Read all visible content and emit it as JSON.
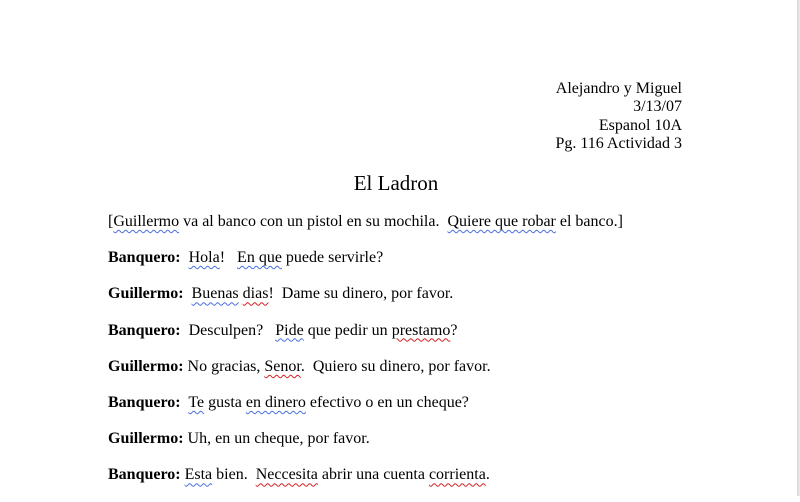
{
  "header": {
    "authors": "Alejandro y Miguel",
    "date": "3/13/07",
    "course": "Espanol 10A",
    "assignment": "Pg. 116 Actividad 3"
  },
  "title": "El Ladron",
  "lines": [
    {
      "speaker": "",
      "segments": [
        {
          "t": "[",
          "m": ""
        },
        {
          "t": "Guillermo",
          "m": "blue"
        },
        {
          "t": " va al banco con un pistol en su mochila.  ",
          "m": ""
        },
        {
          "t": "Quiere que robar",
          "m": "blue"
        },
        {
          "t": " el banco.]",
          "m": ""
        }
      ]
    },
    {
      "speaker": "Banquero:",
      "segments": [
        {
          "t": "  ",
          "m": ""
        },
        {
          "t": "Hola",
          "m": "blue"
        },
        {
          "t": "!   ",
          "m": ""
        },
        {
          "t": "En que",
          "m": "blue"
        },
        {
          "t": " puede servirle?",
          "m": ""
        }
      ]
    },
    {
      "speaker": "Guillermo:",
      "segments": [
        {
          "t": "  ",
          "m": ""
        },
        {
          "t": "Buenas",
          "m": "blue"
        },
        {
          "t": " ",
          "m": ""
        },
        {
          "t": "dias",
          "m": "red"
        },
        {
          "t": "!  Dame su dinero, por favor.",
          "m": ""
        }
      ]
    },
    {
      "speaker": "Banquero:",
      "segments": [
        {
          "t": "  Desculpen?   ",
          "m": ""
        },
        {
          "t": "Pide",
          "m": "blue"
        },
        {
          "t": " que pedir un ",
          "m": ""
        },
        {
          "t": "prestamo",
          "m": "red"
        },
        {
          "t": "?",
          "m": ""
        }
      ]
    },
    {
      "speaker": "Guillermo:",
      "segments": [
        {
          "t": " No gracias, ",
          "m": ""
        },
        {
          "t": "Senor",
          "m": "red"
        },
        {
          "t": ".  Quiero su dinero, por favor.",
          "m": ""
        }
      ]
    },
    {
      "speaker": "Banquero:",
      "segments": [
        {
          "t": "  ",
          "m": ""
        },
        {
          "t": "Te",
          "m": "blue"
        },
        {
          "t": " gusta ",
          "m": ""
        },
        {
          "t": "en dinero",
          "m": "blue"
        },
        {
          "t": " efectivo o en un cheque?",
          "m": ""
        }
      ]
    },
    {
      "speaker": "Guillermo:",
      "segments": [
        {
          "t": " Uh, en un cheque, por favor.",
          "m": ""
        }
      ]
    },
    {
      "speaker": "Banquero:",
      "segments": [
        {
          "t": " ",
          "m": ""
        },
        {
          "t": "Esta",
          "m": "blue"
        },
        {
          "t": " bien.  ",
          "m": ""
        },
        {
          "t": "Neccesita",
          "m": "red"
        },
        {
          "t": " abrir una cuenta ",
          "m": ""
        },
        {
          "t": "corrienta",
          "m": "red"
        },
        {
          "t": ".",
          "m": ""
        }
      ]
    }
  ],
  "colors": {
    "grammar_underline": "#4a6ee0",
    "spelling_underline": "#d42020"
  }
}
